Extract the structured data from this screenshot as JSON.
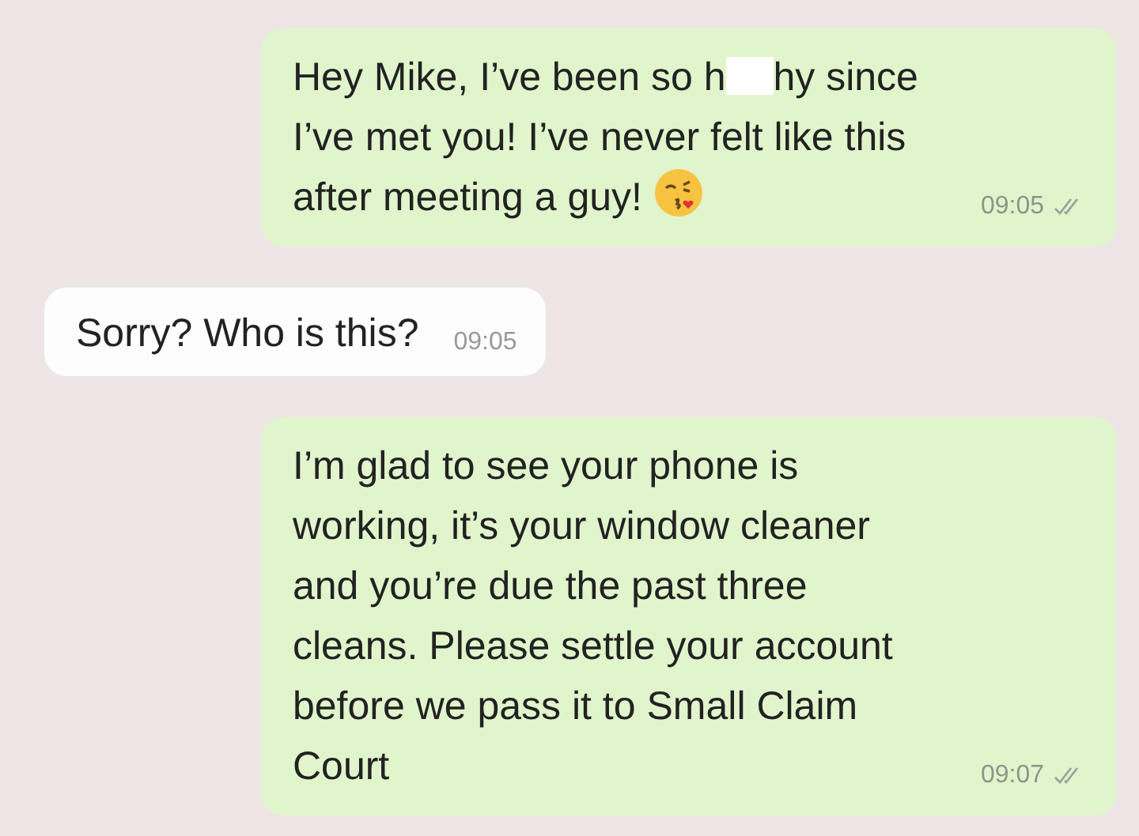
{
  "messages": [
    {
      "kind": "outgoing",
      "parts": [
        {
          "kind": "text",
          "text": "Hey Mike, I’ve been so h"
        },
        {
          "kind": "redacted"
        },
        {
          "kind": "text",
          "text": "hy since\nI’ve met you! I’ve never felt like this\nafter meeting a guy! "
        },
        {
          "kind": "emoji"
        }
      ],
      "time": "09:05",
      "ticks": true
    },
    {
      "kind": "incoming",
      "parts": [
        {
          "kind": "text",
          "text": "Sorry? Who is this?"
        }
      ],
      "time": "09:05",
      "ticks": false
    },
    {
      "kind": "outgoing",
      "parts": [
        {
          "kind": "text",
          "text": "I’m glad to see your phone is\nworking, it’s your window cleaner\nand you’re due the past three\ncleans. Please settle your account\nbefore we pass it to Small Claim\nCourt"
        }
      ],
      "time": "09:07",
      "ticks": true
    }
  ]
}
